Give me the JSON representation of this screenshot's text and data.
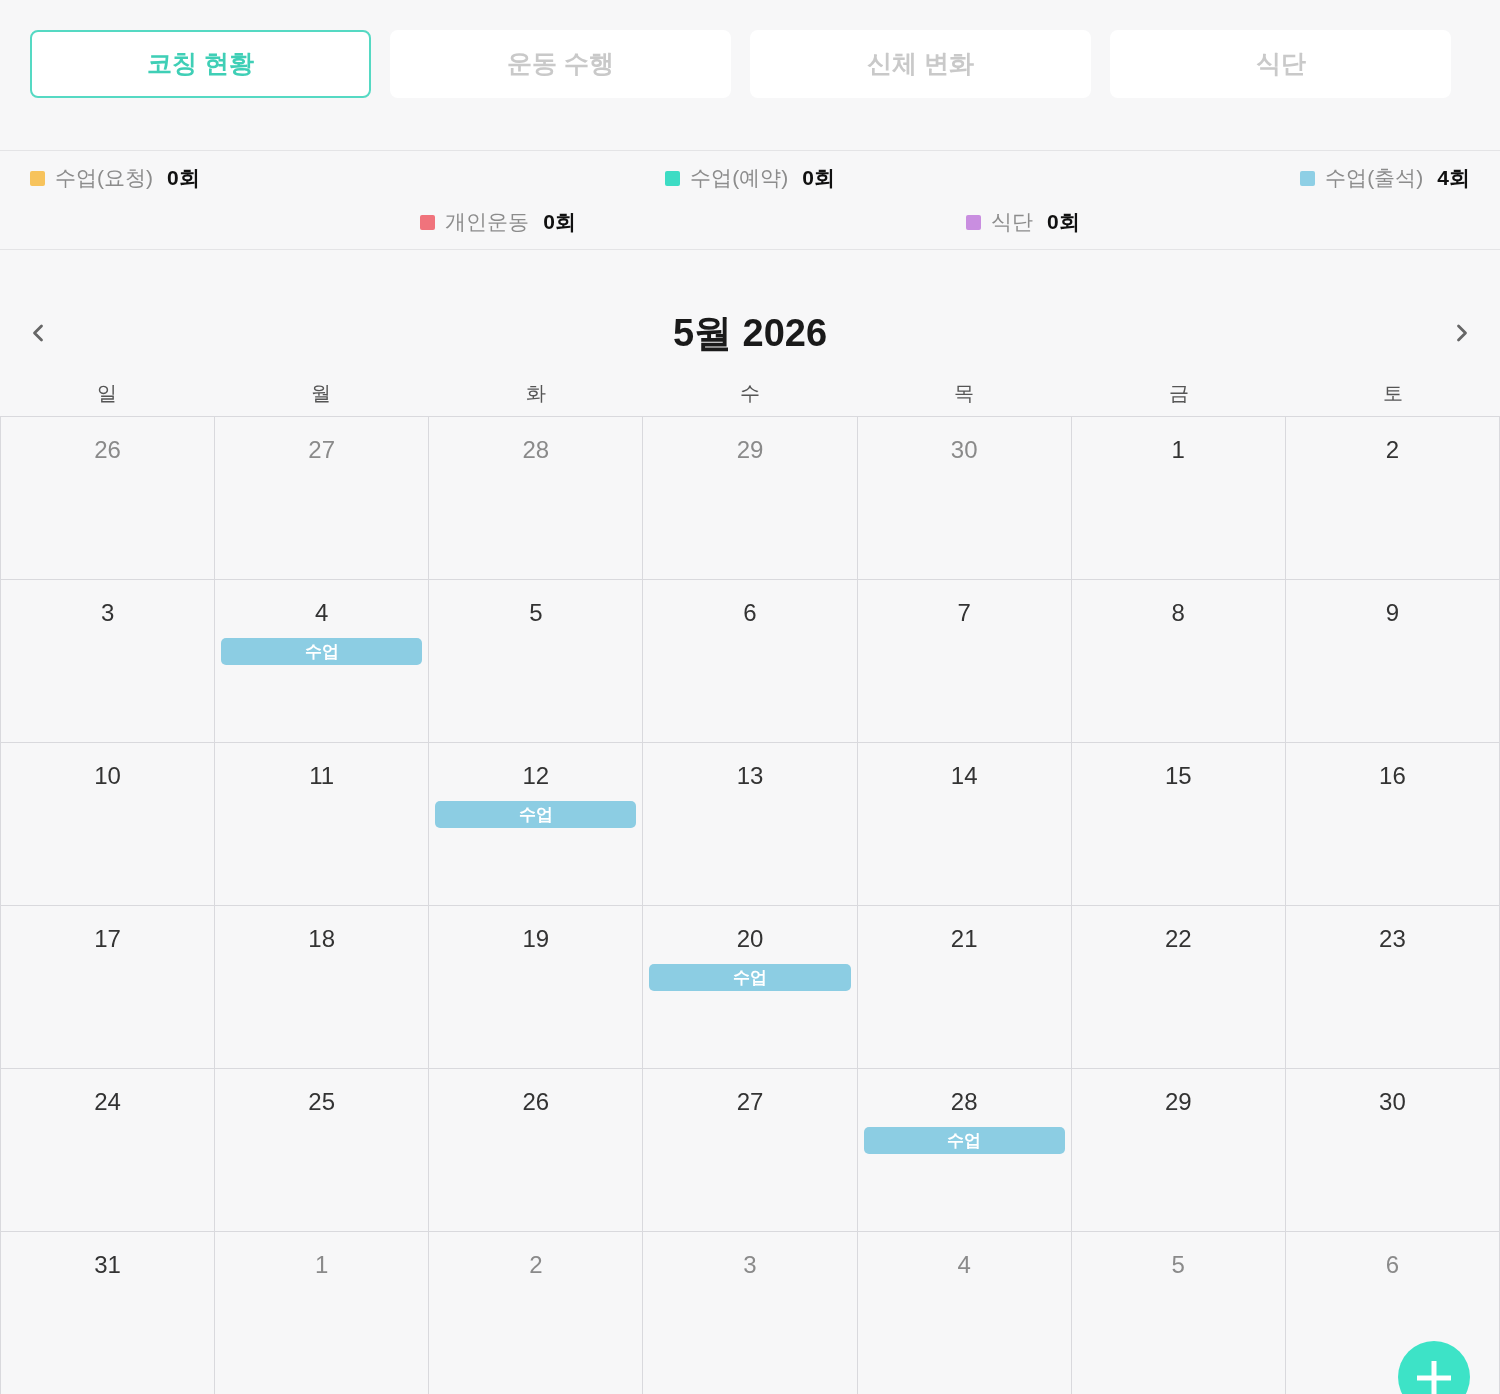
{
  "tabs": [
    {
      "label": "코칭 현황",
      "selected": true
    },
    {
      "label": "운동 수행",
      "selected": false
    },
    {
      "label": "신체 변화",
      "selected": false
    },
    {
      "label": "식단",
      "selected": false
    }
  ],
  "legend": [
    {
      "items": [
        {
          "label": "수업(요청)",
          "count": "0회",
          "color": "#f7c35c"
        },
        {
          "label": "수업(예약)",
          "count": "0회",
          "color": "#3ddcc4"
        },
        {
          "label": "수업(출석)",
          "count": "4회",
          "color": "#8ecfe5"
        }
      ]
    },
    {
      "items": [
        {
          "label": "개인운동",
          "count": "0회",
          "color": "#f0737c"
        },
        {
          "label": "식단",
          "count": "0회",
          "color": "#c98ee0"
        }
      ]
    }
  ],
  "calendar": {
    "title": "5월 2026",
    "weekdays": [
      "일",
      "월",
      "화",
      "수",
      "목",
      "금",
      "토"
    ],
    "weeks": [
      {
        "days": [
          {
            "date": "26",
            "in_month": false
          },
          {
            "date": "27",
            "in_month": false
          },
          {
            "date": "28",
            "in_month": false
          },
          {
            "date": "29",
            "in_month": false
          },
          {
            "date": "30",
            "in_month": false
          },
          {
            "date": "1",
            "in_month": true
          },
          {
            "date": "2",
            "in_month": true
          }
        ]
      },
      {
        "days": [
          {
            "date": "3",
            "in_month": true
          },
          {
            "date": "4",
            "in_month": true,
            "events": [
              {
                "label": "수업"
              }
            ]
          },
          {
            "date": "5",
            "in_month": true
          },
          {
            "date": "6",
            "in_month": true
          },
          {
            "date": "7",
            "in_month": true
          },
          {
            "date": "8",
            "in_month": true
          },
          {
            "date": "9",
            "in_month": true
          }
        ]
      },
      {
        "days": [
          {
            "date": "10",
            "in_month": true
          },
          {
            "date": "11",
            "in_month": true
          },
          {
            "date": "12",
            "in_month": true,
            "events": [
              {
                "label": "수업"
              }
            ]
          },
          {
            "date": "13",
            "in_month": true
          },
          {
            "date": "14",
            "in_month": true
          },
          {
            "date": "15",
            "in_month": true
          },
          {
            "date": "16",
            "in_month": true
          }
        ]
      },
      {
        "days": [
          {
            "date": "17",
            "in_month": true
          },
          {
            "date": "18",
            "in_month": true
          },
          {
            "date": "19",
            "in_month": true
          },
          {
            "date": "20",
            "in_month": true,
            "events": [
              {
                "label": "수업"
              }
            ]
          },
          {
            "date": "21",
            "in_month": true
          },
          {
            "date": "22",
            "in_month": true
          },
          {
            "date": "23",
            "in_month": true
          }
        ]
      },
      {
        "days": [
          {
            "date": "24",
            "in_month": true
          },
          {
            "date": "25",
            "in_month": true
          },
          {
            "date": "26",
            "in_month": true
          },
          {
            "date": "27",
            "in_month": true
          },
          {
            "date": "28",
            "in_month": true,
            "events": [
              {
                "label": "수업"
              }
            ]
          },
          {
            "date": "29",
            "in_month": true
          },
          {
            "date": "30",
            "in_month": true
          }
        ]
      },
      {
        "days": [
          {
            "date": "31",
            "in_month": true
          },
          {
            "date": "1",
            "in_month": false
          },
          {
            "date": "2",
            "in_month": false
          },
          {
            "date": "3",
            "in_month": false
          },
          {
            "date": "4",
            "in_month": false
          },
          {
            "date": "5",
            "in_month": false
          },
          {
            "date": "6",
            "in_month": false
          }
        ]
      }
    ]
  }
}
